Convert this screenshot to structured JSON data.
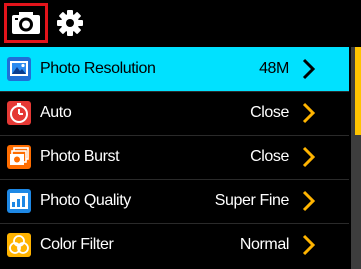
{
  "topbar": {
    "tabs": [
      {
        "icon": "camera-icon",
        "active": true
      },
      {
        "icon": "gear-icon",
        "active": false
      }
    ],
    "active_border_color": "#e3141b"
  },
  "menu": {
    "selected_color": "#00e1ff",
    "chevron_color": "#ffb400",
    "items": [
      {
        "label": "Photo Resolution",
        "value": "48M",
        "icon": "image-icon"
      },
      {
        "label": "Auto",
        "value": "Close",
        "icon": "timer-icon"
      },
      {
        "label": "Photo Burst",
        "value": "Close",
        "icon": "burst-icon"
      },
      {
        "label": "Photo Quality",
        "value": "Super Fine",
        "icon": "quality-icon"
      },
      {
        "label": "Color Filter",
        "value": "Normal",
        "icon": "color-filter-icon"
      }
    ]
  },
  "scrollbar": {
    "thumb_color": "#ffc400"
  }
}
